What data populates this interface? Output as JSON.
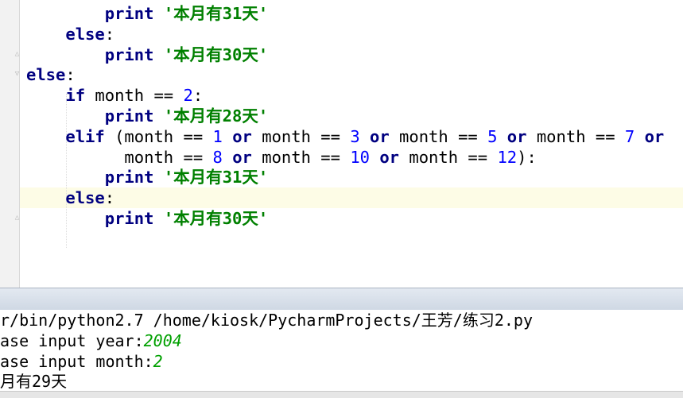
{
  "editor": {
    "lines": [
      {
        "indent": "        ",
        "tokens": [
          {
            "t": "print",
            "c": "kw"
          },
          {
            "t": " "
          },
          {
            "t": "'本月有31天'",
            "c": "str"
          }
        ]
      },
      {
        "indent": "    ",
        "tokens": [
          {
            "t": "else",
            "c": "kw"
          },
          {
            "t": ":"
          }
        ]
      },
      {
        "indent": "        ",
        "tokens": [
          {
            "t": "print",
            "c": "kw"
          },
          {
            "t": " "
          },
          {
            "t": "'本月有30天'",
            "c": "str"
          }
        ]
      },
      {
        "indent": "",
        "tokens": [
          {
            "t": "else",
            "c": "kw"
          },
          {
            "t": ":"
          }
        ]
      },
      {
        "indent": "    ",
        "tokens": [
          {
            "t": "if",
            "c": "kw"
          },
          {
            "t": " month == "
          },
          {
            "t": "2",
            "c": "num"
          },
          {
            "t": ":"
          }
        ]
      },
      {
        "indent": "        ",
        "tokens": [
          {
            "t": "print",
            "c": "kw"
          },
          {
            "t": " "
          },
          {
            "t": "'本月有28天'",
            "c": "str"
          }
        ]
      },
      {
        "indent": "    ",
        "tokens": [
          {
            "t": "elif",
            "c": "kw"
          },
          {
            "t": " (month == "
          },
          {
            "t": "1",
            "c": "num"
          },
          {
            "t": " "
          },
          {
            "t": "or",
            "c": "kw"
          },
          {
            "t": " month == "
          },
          {
            "t": "3",
            "c": "num"
          },
          {
            "t": " "
          },
          {
            "t": "or",
            "c": "kw"
          },
          {
            "t": " month == "
          },
          {
            "t": "5",
            "c": "num"
          },
          {
            "t": " "
          },
          {
            "t": "or",
            "c": "kw"
          },
          {
            "t": " month == "
          },
          {
            "t": "7",
            "c": "num"
          },
          {
            "t": " "
          },
          {
            "t": "or",
            "c": "kw"
          }
        ]
      },
      {
        "indent": "          ",
        "tokens": [
          {
            "t": "month == "
          },
          {
            "t": "8",
            "c": "num"
          },
          {
            "t": " "
          },
          {
            "t": "or",
            "c": "kw"
          },
          {
            "t": " month == "
          },
          {
            "t": "10",
            "c": "num"
          },
          {
            "t": " "
          },
          {
            "t": "or",
            "c": "kw"
          },
          {
            "t": " month == "
          },
          {
            "t": "12",
            "c": "num"
          },
          {
            "t": "):"
          }
        ]
      },
      {
        "indent": "        ",
        "tokens": [
          {
            "t": "print",
            "c": "kw"
          },
          {
            "t": " "
          },
          {
            "t": "'本月有31天'",
            "c": "str"
          }
        ]
      },
      {
        "indent": "    ",
        "tokens": [
          {
            "t": "else",
            "c": "kw"
          },
          {
            "t": ":"
          }
        ]
      },
      {
        "indent": "        ",
        "tokens": [
          {
            "t": "print",
            "c": "kw"
          },
          {
            "t": " "
          },
          {
            "t": "'本月有30天'",
            "c": "str"
          }
        ]
      }
    ]
  },
  "console": {
    "lines": [
      {
        "tokens": [
          {
            "t": "r/bin/python2.7 /home/kiosk/PycharmProjects/王芳/练习2.py"
          }
        ]
      },
      {
        "tokens": [
          {
            "t": "ase input year:"
          },
          {
            "t": "2004",
            "c": "in"
          }
        ]
      },
      {
        "tokens": [
          {
            "t": "ase input month:"
          },
          {
            "t": "2",
            "c": "in"
          }
        ]
      },
      {
        "tokens": [
          {
            "t": "月有29天"
          }
        ]
      }
    ]
  },
  "colors": {
    "keyword": "#000080",
    "string": "#008000",
    "number": "#0000ff",
    "user_input": "#00a000",
    "caret_line": "#fdfce6"
  },
  "icons": [
    "fold-end-icon",
    "fold-start-icon"
  ]
}
